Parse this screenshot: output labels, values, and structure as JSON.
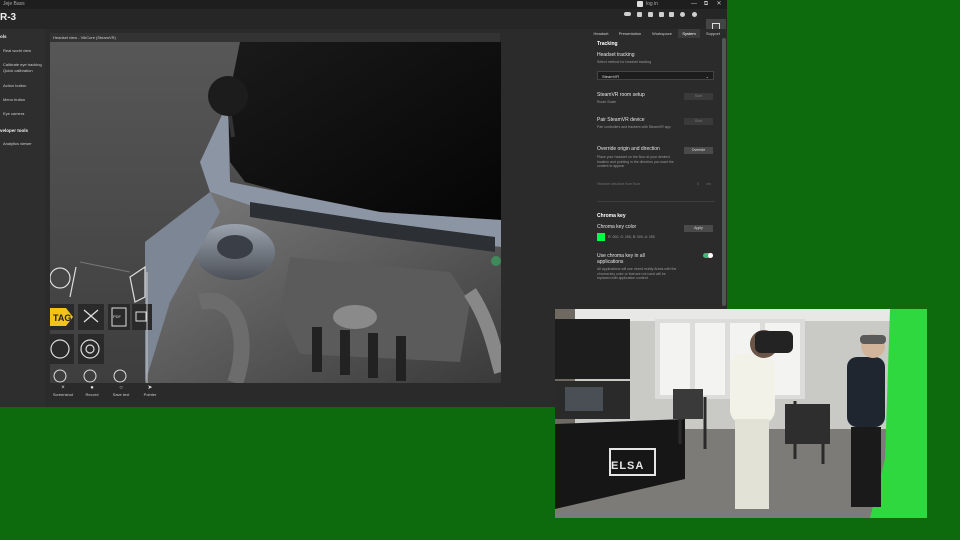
{
  "titlebar": {
    "app_title": "Jeje Bass",
    "login_label": "log in",
    "minimize": "—",
    "maximize": "⧉",
    "close": "✕"
  },
  "topbar": {
    "brand": "R-3",
    "icon_labels": [
      "",
      "",
      "",
      "",
      "",
      "",
      "",
      ""
    ]
  },
  "left_panel": {
    "section_top": "ols",
    "items": [
      "Real world view",
      "Calibrate eye tracking",
      "Quick calibration",
      "Action button",
      "Menu button",
      "Eye camera"
    ],
    "section_bottom": "veloper tools",
    "items_bottom": [
      "Analytics viewer"
    ]
  },
  "viewport": {
    "header": "Headset view - VibCore (SteamVR)",
    "toolbar": [
      {
        "icon": "×",
        "label": "Screenshot"
      },
      {
        "icon": "●",
        "label": "Record"
      },
      {
        "icon": "○",
        "label": "Save text"
      },
      {
        "icon": "➤",
        "label": "Pointer"
      }
    ],
    "tool_badge": "TAG",
    "pdf_label": "PDF"
  },
  "right_panel": {
    "tabs": [
      "Headset",
      "Presentation",
      "Workspace",
      "System",
      "Support"
    ],
    "active_tab": "System",
    "tracking": {
      "title": "Tracking",
      "headset_tracking_label": "Headset tracking",
      "headset_tracking_sub": "Select method for headset tracking",
      "headset_tracking_value": "SteamVR",
      "room_setup_label": "SteamVR room setup",
      "room_setup_sub": "Room Scale",
      "room_setup_btn": "Start",
      "pair_label": "Pair SteamVR device",
      "pair_sub": "Pair controllers and trackers with SteamVR app",
      "pair_btn": "Start",
      "override_label": "Override origin and direction",
      "override_sub": "Place your headset on the floor at your desired location and pointing in the direction you want the content to appear",
      "override_btn": "Override",
      "absolute_label": "Headset absolute from floor",
      "absolute_value": "0",
      "absolute_unit": "cm"
    },
    "chroma": {
      "title": "Chroma key",
      "color_label": "Chroma key color",
      "color_value": "R: 000, G: 255, B: 000, A: 255",
      "color_hex": "#00ff44",
      "apply_btn": "Apply",
      "all_apps_label": "Use chroma key in all applications",
      "all_apps_sub": "All applications will use mixed reality Areas with the chroma key color or that are not used will be replaced with application content",
      "toggle_on": true
    }
  },
  "camera": {
    "sign_text": "ELSA"
  },
  "colors": {
    "green_screen": "#0d6b0d",
    "accent_toggle": "#3cb87a",
    "tag_yellow": "#f2c418"
  }
}
